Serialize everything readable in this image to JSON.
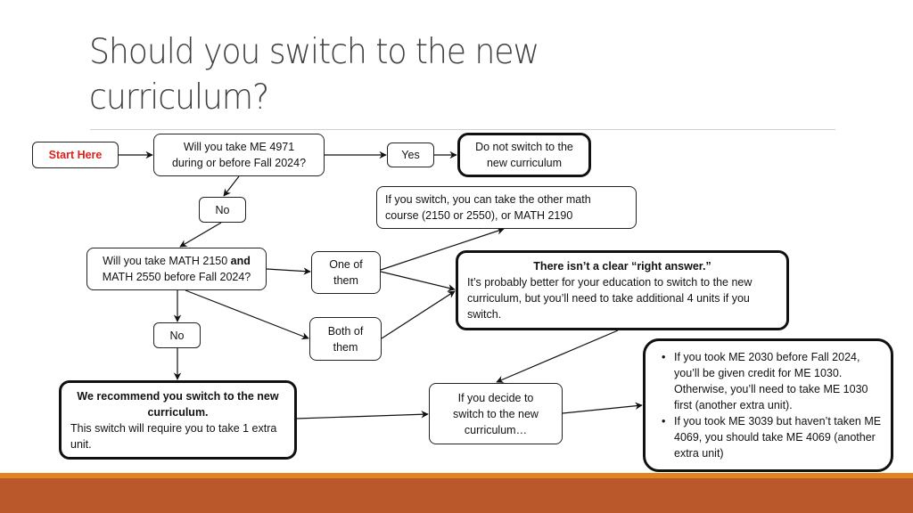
{
  "slide": {
    "title": "Should you switch to the new curriculum?"
  },
  "colors": {
    "start_text": "#e0201b",
    "footer_stripe": "#e1851f",
    "footer_band": "#bb582b",
    "title_text": "#404040"
  },
  "flowchart": {
    "start": {
      "label": "Start Here"
    },
    "q1": {
      "line1": "Will you take ME 4971",
      "line2": "during or before Fall 2024?"
    },
    "yes": {
      "label": "Yes"
    },
    "do_not_switch": {
      "line1": "Do not switch to the",
      "line2": "new curriculum"
    },
    "math_info": {
      "line1": "If you switch, you can take the other math",
      "line2": "course (2150 or 2550), or MATH 2190"
    },
    "no1": {
      "label": "No"
    },
    "q2": {
      "line1_prefix": "Will you take MATH 2150 ",
      "line1_bold": "and",
      "line2": "MATH 2550 before Fall 2024?"
    },
    "one_of_them": {
      "line1": "One of",
      "line2": "them"
    },
    "both_of_them": {
      "line1": "Both of",
      "line2": "them"
    },
    "unclear": {
      "heading": "There isn’t a clear “right answer.”",
      "body": "It’s probably better for your education to switch to the new curriculum, but you’ll need to take additional 4 units if you switch."
    },
    "no2": {
      "label": "No"
    },
    "recommend": {
      "heading": "We recommend you switch to the new curriculum.",
      "body": "This switch will require you to take 1 extra unit."
    },
    "decide": {
      "line1": "If you decide to",
      "line2": "switch to the new",
      "line3": "curriculum…"
    },
    "bullets": {
      "items": [
        "If you took ME 2030 before Fall 2024, you’ll be given credit for ME 1030. Otherwise, you’ll need to take ME 1030 first (another extra unit).",
        "If you took ME 3039 but haven’t taken ME 4069, you should take ME 4069 (another extra unit)"
      ]
    }
  }
}
